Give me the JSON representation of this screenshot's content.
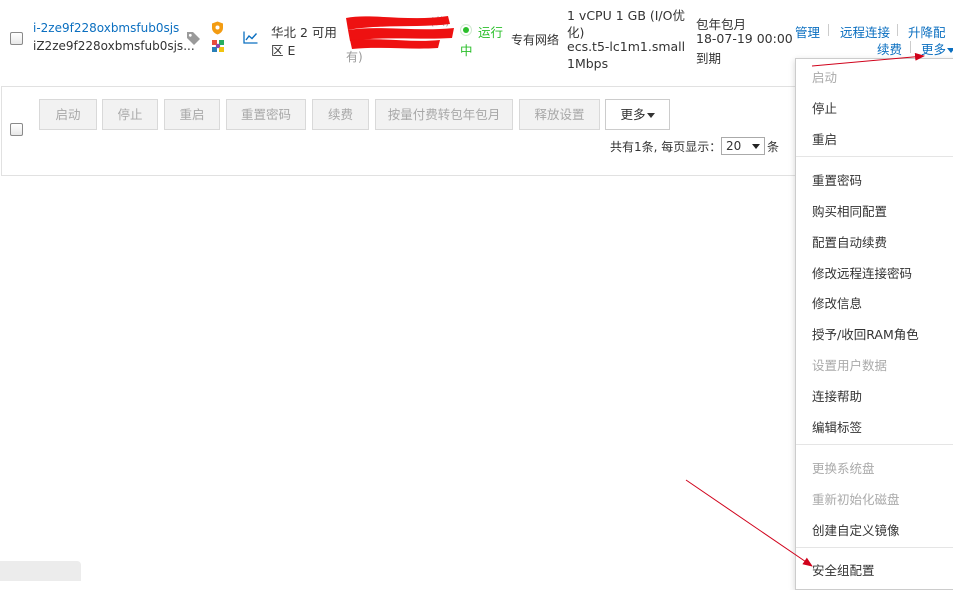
{
  "instance": {
    "id": "i-2ze9f228oxbmsfub0sjs",
    "name": "iZ2ze9f228oxbmsfub0sjs...",
    "zone_line1": "华北 2 可用",
    "zone_line2": "区 E",
    "redacted_line1": "(公)",
    "redacted_line2": "有)",
    "status_line1": "运行",
    "status_line2": "中",
    "network": "专有网络",
    "spec_line1": "1 vCPU 1 GB (I/O优",
    "spec_line2": "化)",
    "spec_line3": "ecs.t5-lc1m1.small",
    "spec_line4": "1Mbps",
    "billing_line1": "包年包月",
    "billing_line2": "18-07-19 00:00",
    "billing_line3": "到期",
    "actions": {
      "manage": "管理",
      "remote": "远程连接",
      "upgrade": "升降配",
      "renew": "续费",
      "more": "更多"
    }
  },
  "toolbar": {
    "start": "启动",
    "stop": "停止",
    "restart": "重启",
    "reset_password": "重置密码",
    "renew": "续费",
    "convert": "按量付费转包年包月",
    "release": "释放设置",
    "more": "更多"
  },
  "pagination": {
    "summary": "共有1条, 每页显示：",
    "page_size": "20",
    "unit": "条"
  },
  "menu": {
    "items": [
      {
        "label": "启动",
        "disabled": true
      },
      {
        "label": "停止",
        "disabled": false
      },
      {
        "label": "重启",
        "disabled": false
      },
      {
        "label": "重置密码",
        "disabled": false
      },
      {
        "label": "购买相同配置",
        "disabled": false
      },
      {
        "label": "配置自动续费",
        "disabled": false
      },
      {
        "label": "修改远程连接密码",
        "disabled": false
      },
      {
        "label": "修改信息",
        "disabled": false
      },
      {
        "label": "授予/收回RAM角色",
        "disabled": false
      },
      {
        "label": "设置用户数据",
        "disabled": true
      },
      {
        "label": "连接帮助",
        "disabled": false
      },
      {
        "label": "编辑标签",
        "disabled": false
      },
      {
        "label": "更换系统盘",
        "disabled": true
      },
      {
        "label": "重新初始化磁盘",
        "disabled": true
      },
      {
        "label": "创建自定义镜像",
        "disabled": false
      },
      {
        "label": "安全组配置",
        "disabled": false
      }
    ]
  },
  "colors": {
    "link": "#0b6fc0",
    "status_green": "#2bbf2b",
    "annotation_red": "#d0021b"
  }
}
